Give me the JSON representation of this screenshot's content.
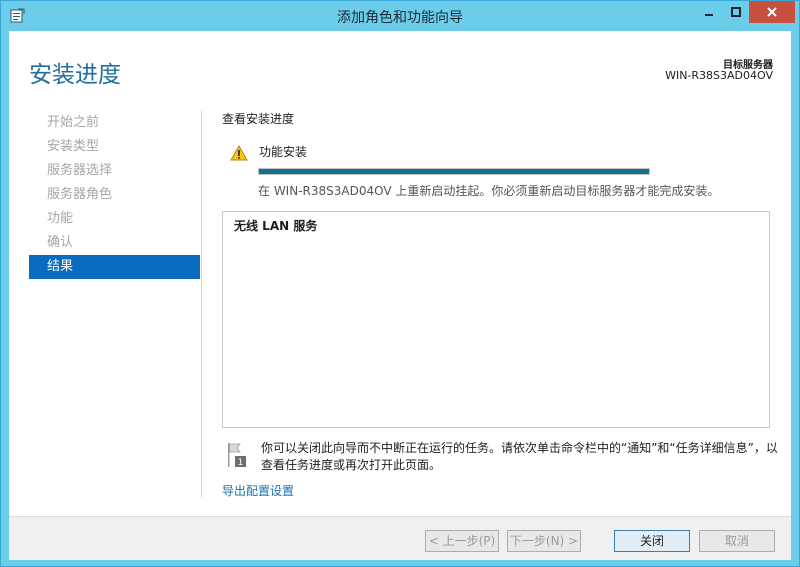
{
  "window": {
    "title": "添加角色和功能向导"
  },
  "header": {
    "page_title": "安装进度",
    "target_label": "目标服务器",
    "target_value": "WIN-R38S3AD04OV"
  },
  "nav": {
    "items": [
      {
        "label": "开始之前",
        "active": false
      },
      {
        "label": "安装类型",
        "active": false
      },
      {
        "label": "服务器选择",
        "active": false
      },
      {
        "label": "服务器角色",
        "active": false
      },
      {
        "label": "功能",
        "active": false
      },
      {
        "label": "确认",
        "active": false
      },
      {
        "label": "结果",
        "active": true
      }
    ]
  },
  "main": {
    "section_title": "查看安装进度",
    "feature_label": "功能安装",
    "progress_fraction": 1.0,
    "restart_message": "在 WIN-R38S3AD04OV 上重新启动挂起。你必须重新启动目标服务器才能完成安装。",
    "results": [
      "无线 LAN 服务"
    ],
    "info_text": "你可以关闭此向导而不中断正在运行的任务。请依次单击命令栏中的“通知”和“任务详细信息”，以查看任务进度或再次打开此页面。",
    "export_link": "导出配置设置"
  },
  "footer": {
    "prev_label": "< 上一步(P)",
    "next_label": "下一步(N) >",
    "close_label": "关闭",
    "cancel_label": "取消"
  },
  "icons": {
    "app": "wizard-app-icon",
    "warning": "warning-icon",
    "flag": "notification-flag-icon"
  },
  "colors": {
    "titlebar": "#6ccdeb",
    "accent": "#1e6e9e",
    "nav_active": "#0a6cbf",
    "progress": "#16718f",
    "close_button": "#c7503f",
    "link": "#1a6fa8"
  }
}
